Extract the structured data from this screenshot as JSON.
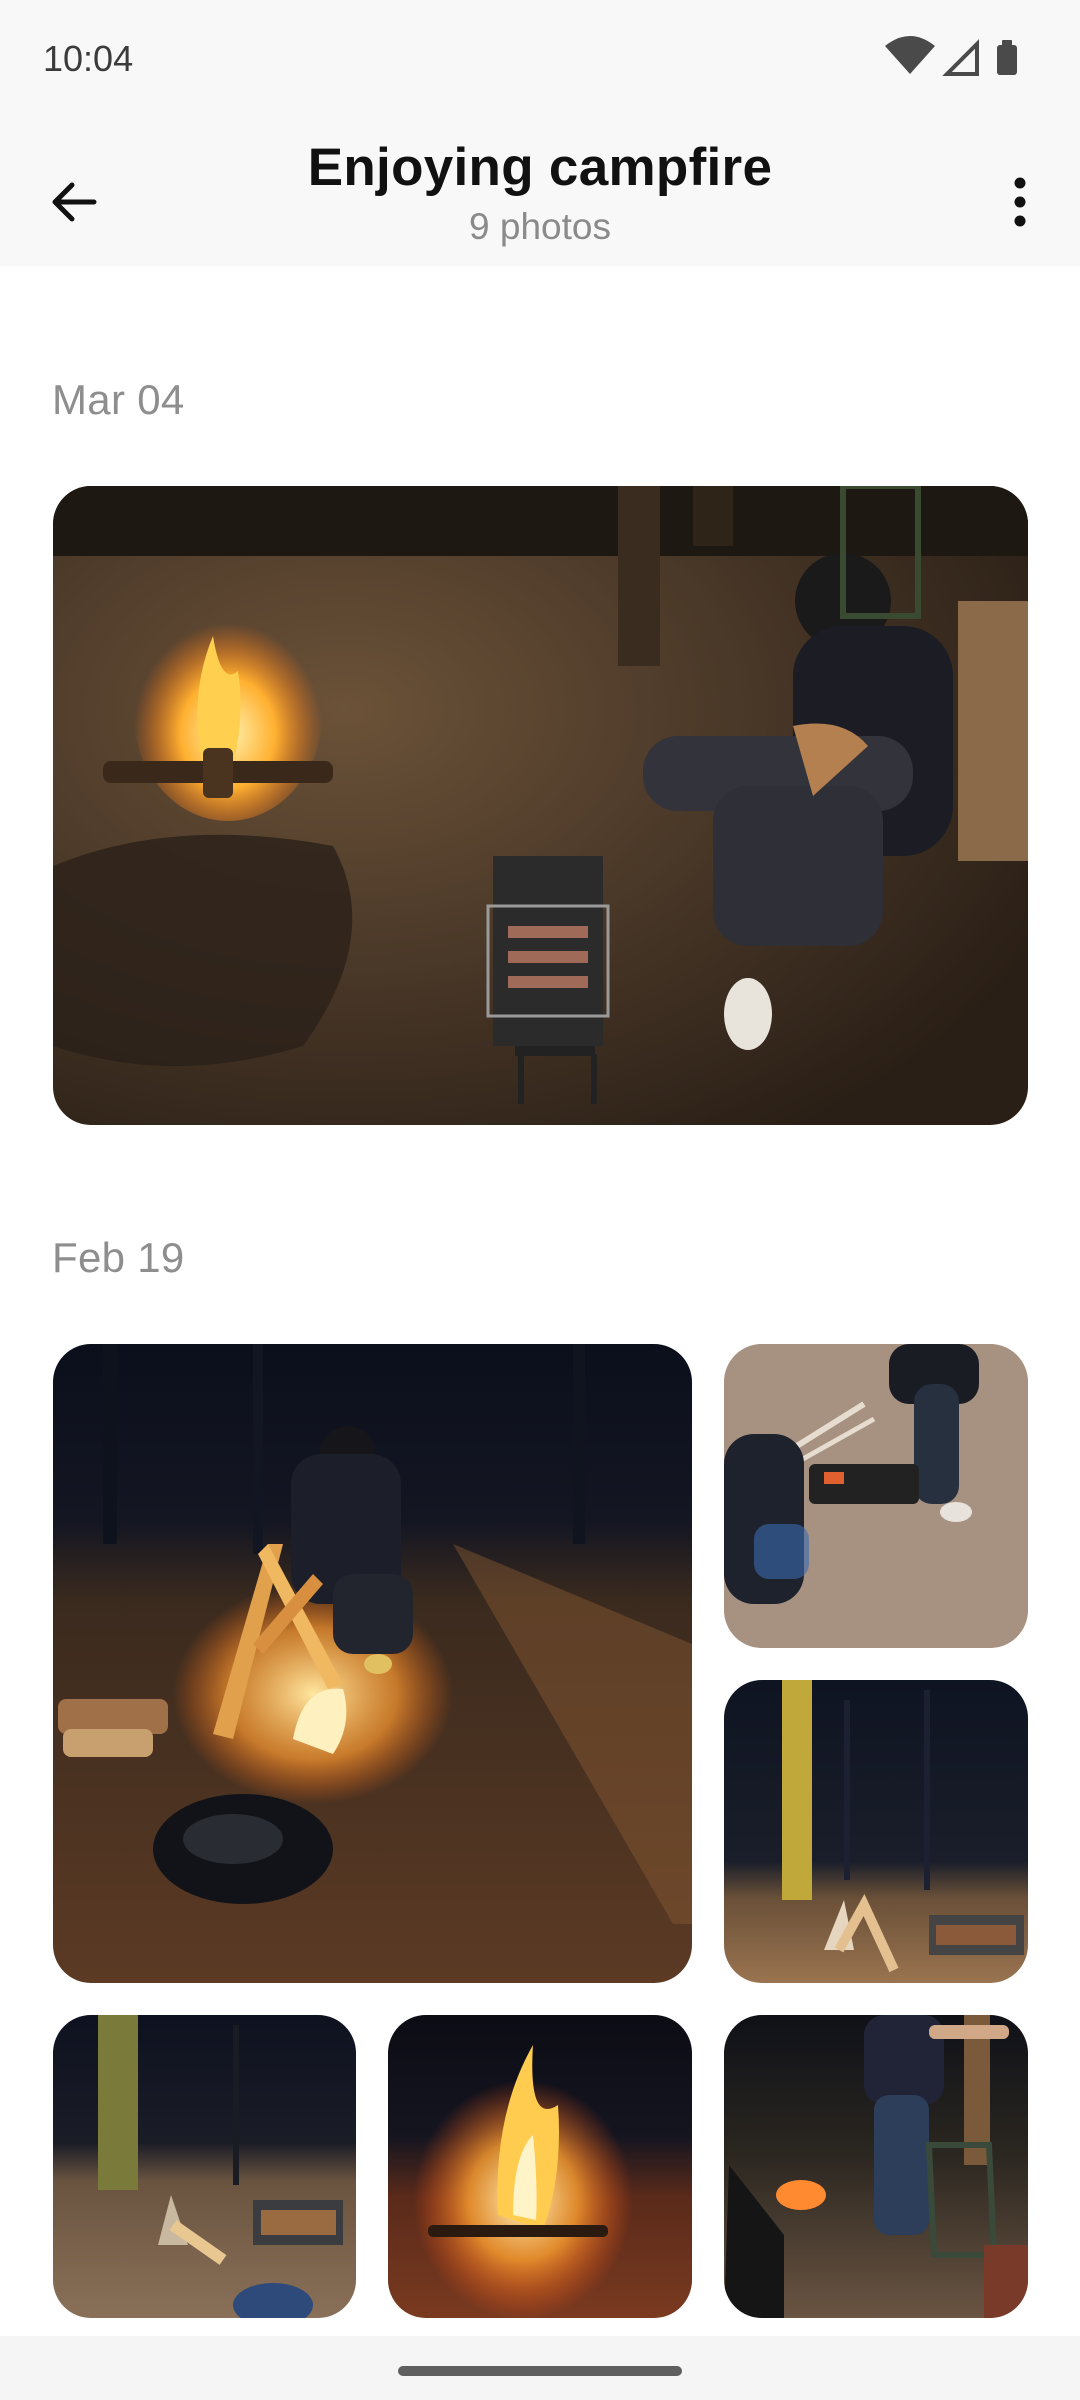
{
  "status_bar": {
    "time": "10:04",
    "icons": [
      "wifi-icon",
      "cellular-icon",
      "battery-icon"
    ]
  },
  "app_bar": {
    "title": "Enjoying campfire",
    "subtitle": "9 photos",
    "back_icon": "arrow-left-icon",
    "more_icon": "more-vert-icon"
  },
  "sections": [
    {
      "date": "Mar 04",
      "photos": [
        "campfire-grill-photo"
      ]
    },
    {
      "date": "Feb 19",
      "photos": [
        "building-fire-photo",
        "roasting-skewers-photo",
        "forest-night-photo",
        "woodpile-grill-photo",
        "bonfire-photo",
        "chairs-campfire-photo"
      ]
    }
  ],
  "colors": {
    "background": "#ffffff",
    "bar": "#f8f8f8",
    "date_text": "#8e8e8e",
    "title_text": "#111111"
  }
}
